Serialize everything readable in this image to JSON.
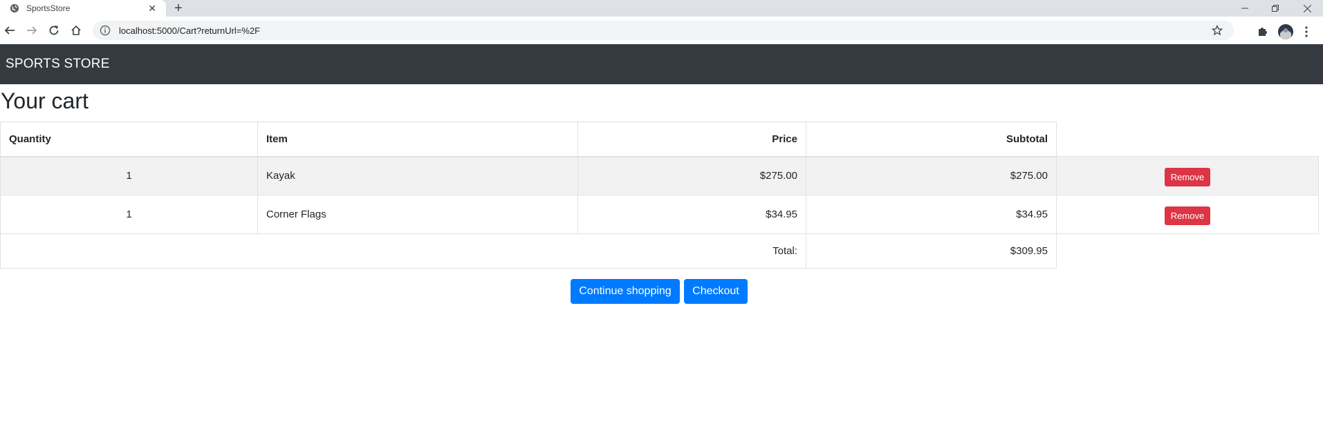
{
  "browser": {
    "tab_title": "SportsStore",
    "url": "localhost:5000/Cart?returnUrl=%2F"
  },
  "navbar": {
    "brand": "SPORTS STORE"
  },
  "page": {
    "heading": "Your cart"
  },
  "cart": {
    "headers": {
      "quantity": "Quantity",
      "item": "Item",
      "price": "Price",
      "subtotal": "Subtotal"
    },
    "rows": [
      {
        "quantity": "1",
        "item": "Kayak",
        "price": "$275.00",
        "subtotal": "$275.00",
        "remove_label": "Remove"
      },
      {
        "quantity": "1",
        "item": "Corner Flags",
        "price": "$34.95",
        "subtotal": "$34.95",
        "remove_label": "Remove"
      }
    ],
    "total_label": "Total:",
    "total_value": "$309.95"
  },
  "buttons": {
    "continue_label": "Continue shopping",
    "checkout_label": "Checkout"
  },
  "colors": {
    "navbar": "#343a40",
    "primary": "#007bff",
    "danger": "#dc3545"
  }
}
